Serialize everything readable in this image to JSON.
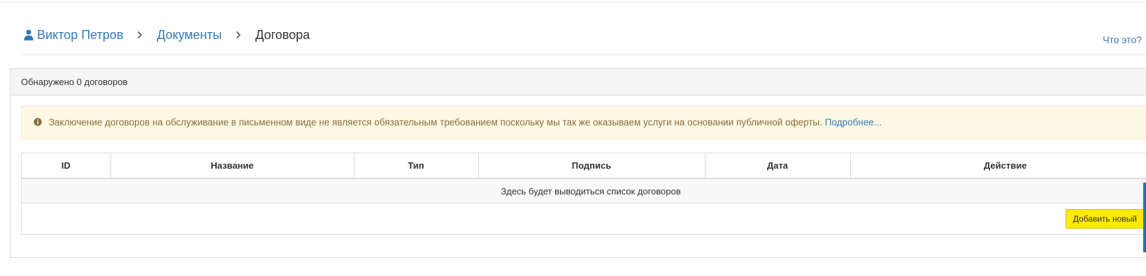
{
  "breadcrumb": {
    "user": "Виктор Петров",
    "documents": "Документы",
    "current": "Договора",
    "separator": "›"
  },
  "help_link": "Что это?",
  "panel": {
    "heading": "Обнаружено 0 договоров"
  },
  "alert": {
    "text": "Заключение договоров на обслуживание в письменном виде не является обязательным требованием поскольку мы так же оказываем услуги на основании публичной оферты.",
    "link": "Подробнее..."
  },
  "table": {
    "columns": [
      "ID",
      "Название",
      "Тип",
      "Подпись",
      "Дата",
      "Действие"
    ],
    "empty_message": "Здесь будет выводиться список договоров"
  },
  "add_button": "Добавить новый",
  "colors": {
    "link": "#337ab7",
    "alert_bg": "#fcf8e3",
    "alert_text": "#8a6d3b",
    "button_bg": "#ffea00",
    "scroll_accent": "#1f6fc5"
  },
  "icons": {
    "user": "user-icon",
    "info": "info-circle-icon",
    "separator": "chevron-right-icon"
  }
}
